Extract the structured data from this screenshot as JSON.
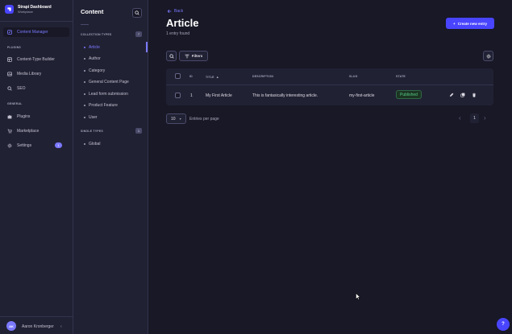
{
  "brand": {
    "title": "Strapi Dashboard",
    "subtitle": "Workplace"
  },
  "sidebar": {
    "content_manager": "Content Manager",
    "plugins_section": "PLUGINS",
    "plugins": [
      "Content-Type Builder",
      "Media Library",
      "SEO"
    ],
    "general_section": "GENERAL",
    "general": [
      "Plugins",
      "Marketplace",
      "Settings"
    ],
    "settings_badge": "1",
    "user": {
      "initials": "AK",
      "name": "Aaron Kronberger"
    }
  },
  "content_nav": {
    "title": "Content",
    "collection_section": "COLLECTION TYPES",
    "collection_count": "7",
    "collection_items": [
      "Article",
      "Author",
      "Category",
      "General Content Page",
      "Lead form submission",
      "Product Feature",
      "User"
    ],
    "single_section": "SINGLE TYPES",
    "single_count": "1",
    "single_items": [
      "Global"
    ]
  },
  "main": {
    "back": "Back",
    "title": "Article",
    "subtitle": "1 entry found",
    "create_button": "Create new entry",
    "filters_button": "Filters"
  },
  "table": {
    "headers": [
      "ID",
      "TITLE",
      "DESCRIPTION",
      "SLUG",
      "STATE"
    ],
    "rows": [
      {
        "id": "1",
        "title": "My First Article",
        "description": "This is fantasically interesting article.",
        "slug": "my-first-article",
        "state": "Published"
      }
    ]
  },
  "pagination": {
    "per_page": "10",
    "per_page_label": "Entries per page",
    "current_page": "1"
  },
  "help": {
    "label": "?"
  },
  "colors": {
    "accent": "#7b79ff",
    "primary": "#4945ff",
    "published": "#55cb85"
  }
}
